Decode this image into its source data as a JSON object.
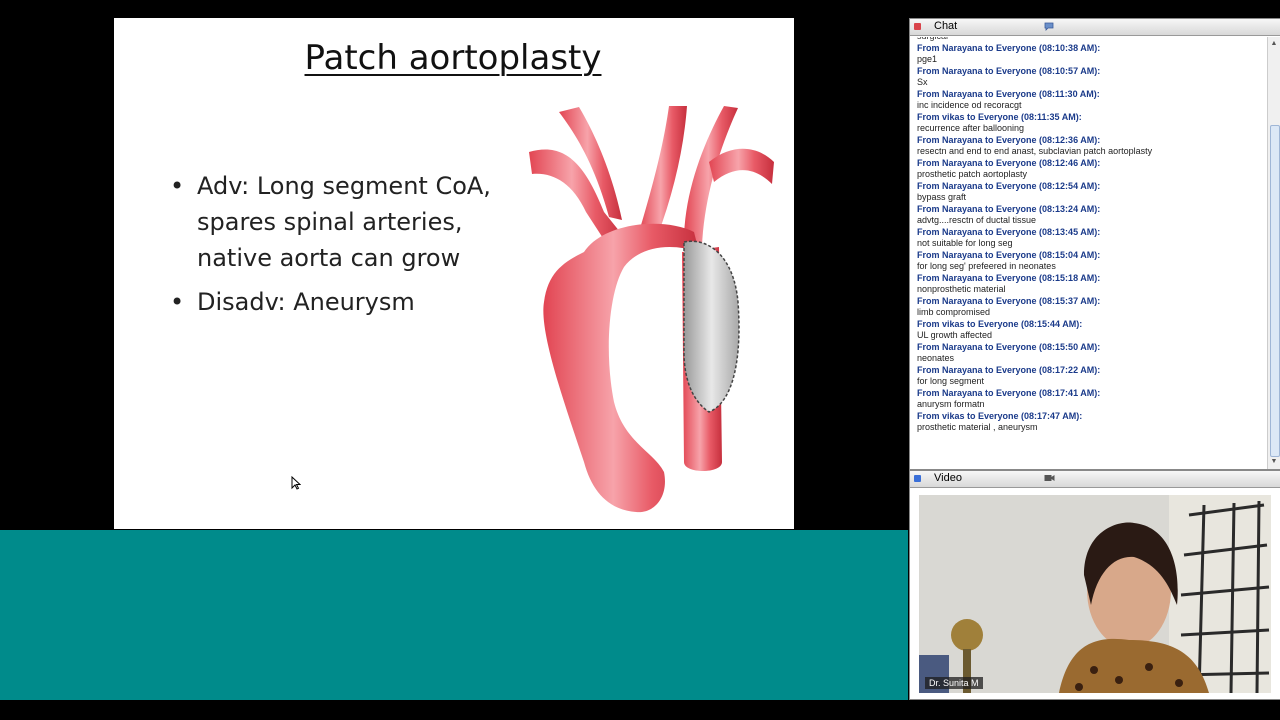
{
  "slide": {
    "title": "Patch aortoplasty",
    "bullets": [
      "Adv: Long segment CoA, spares spinal arteries, native aorta can grow",
      "Disadv: Aneurysm"
    ]
  },
  "chat": {
    "title": "Chat",
    "partial_line": "surgical",
    "messages": [
      {
        "from": "From Narayana to Everyone (08:10:38 AM):",
        "text": "pge1"
      },
      {
        "from": "From Narayana to Everyone (08:10:57 AM):",
        "text": "Sx"
      },
      {
        "from": "From Narayana to Everyone (08:11:30 AM):",
        "text": "inc incidence od recoracgt"
      },
      {
        "from": "From vikas to Everyone (08:11:35 AM):",
        "text": "recurrence after ballooning"
      },
      {
        "from": "From Narayana to Everyone (08:12:36 AM):",
        "text": "resectn and end to end anast, subclavian patch aortoplasty"
      },
      {
        "from": "From Narayana to Everyone (08:12:46 AM):",
        "text": "prosthetic patch aortoplasty"
      },
      {
        "from": "From Narayana to Everyone (08:12:54 AM):",
        "text": "bypass graft"
      },
      {
        "from": "From Narayana to Everyone (08:13:24 AM):",
        "text": "advtg....resctn of ductal tissue"
      },
      {
        "from": "From Narayana to Everyone (08:13:45 AM):",
        "text": "not suitable for long seg"
      },
      {
        "from": "From Narayana to Everyone (08:15:04 AM):",
        "text": "for long seg' prefeered in neonates"
      },
      {
        "from": "From Narayana to Everyone (08:15:18 AM):",
        "text": "nonprosthetic material"
      },
      {
        "from": "From Narayana to Everyone (08:15:37 AM):",
        "text": "limb compromised"
      },
      {
        "from": "From vikas to Everyone (08:15:44 AM):",
        "text": "UL growth affected"
      },
      {
        "from": "From Narayana to Everyone (08:15:50 AM):",
        "text": "neonates"
      },
      {
        "from": "From Narayana to Everyone (08:17:22 AM):",
        "text": "for long segment"
      },
      {
        "from": "From Narayana to Everyone (08:17:41 AM):",
        "text": "anurysm formatn"
      },
      {
        "from": "From vikas to Everyone (08:17:47 AM):",
        "text": "prosthetic material , aneurysm"
      }
    ]
  },
  "video": {
    "title": "Video",
    "presenter_name": "Dr. Sunita M"
  },
  "colors": {
    "accent_teal": "#008b8b",
    "chat_header_dot": "#d9434a",
    "video_header_dot": "#3a6fd8",
    "chat_from_text": "#1a3a8a"
  },
  "icons": {
    "chat_header_icon": "speech-bubble-icon",
    "video_header_icon": "camera-icon",
    "cursor": "mouse-pointer-icon"
  }
}
